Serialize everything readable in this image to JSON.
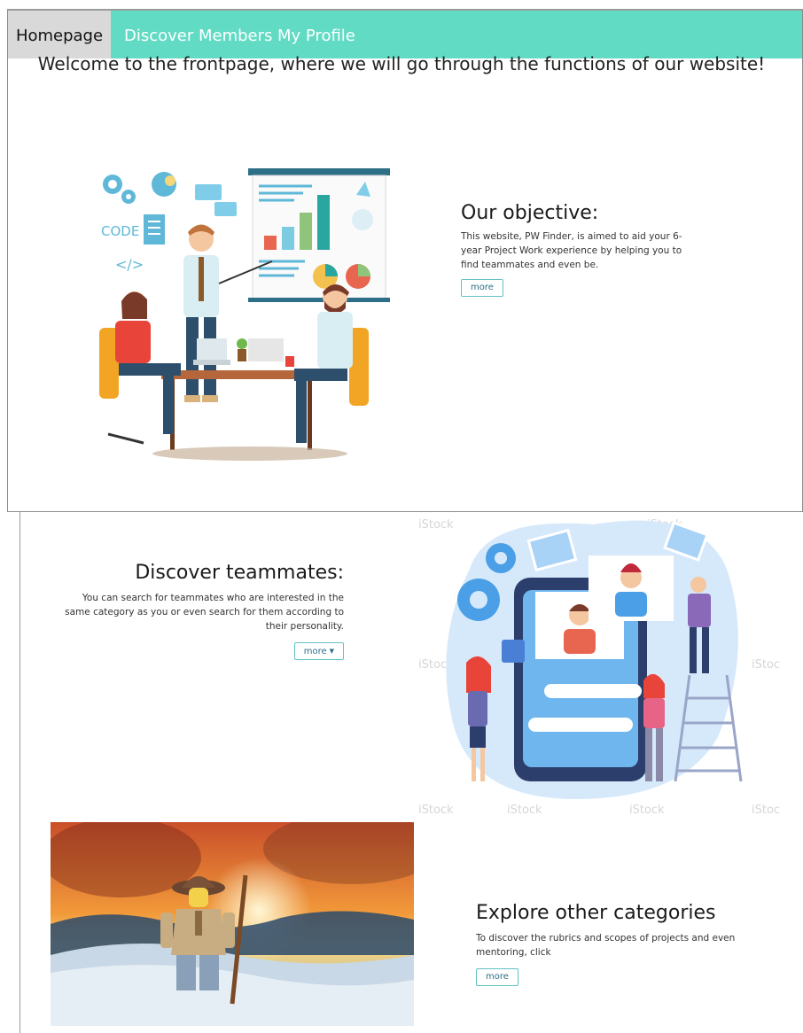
{
  "nav": {
    "items": [
      {
        "label": "Homepage",
        "active": true
      },
      {
        "label": "Discover Members",
        "active": false
      },
      {
        "label": "My Profile",
        "active": false
      }
    ],
    "color": "#62dbc4",
    "active_bg": "#d9d9d9"
  },
  "welcome": "Welcome to the frontpage, where we will go through the functions of our website!",
  "objective": {
    "title": "Our objective:",
    "text": "This website, PW Finder, is aimed to aid your 6-year Project Work experience by helping you to find teammates and even be.",
    "button": "more"
  },
  "discover": {
    "title": "Discover teammates:",
    "text": "You can search for teammates who are interested in the same category as you or even search for them according to their personality.",
    "button": "more",
    "caret_icon": "caret-down-icon"
  },
  "explore": {
    "title": "Explore other categories",
    "text": "To discover the rubrics and scopes of projects and even mentoring, click",
    "button": "more"
  },
  "illustration1": {
    "code_label": "CODE",
    "tag_label": "</>"
  },
  "watermark": "iStock",
  "colors": {
    "teal": "#62dbc4",
    "button_border": "#62c2c4"
  }
}
